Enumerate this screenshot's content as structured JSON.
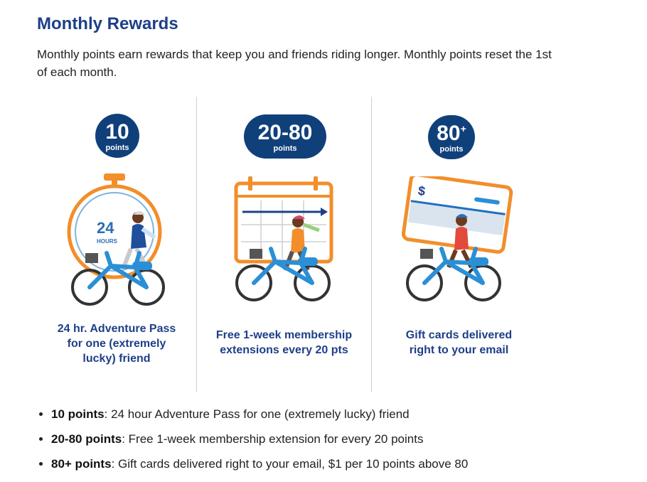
{
  "title": "Monthly Rewards",
  "intro": "Monthly points earn rewards that keep you and friends riding longer. Monthly points reset the 1st of each month.",
  "tiers": [
    {
      "badge_number": "10",
      "badge_sup": "",
      "badge_label": "points",
      "timer_big": "24",
      "timer_small": "HOURS",
      "caption_lines": [
        "24 hr. Adventure Pass",
        "for one (extremely",
        "lucky) friend"
      ]
    },
    {
      "badge_number": "20-80",
      "badge_sup": "",
      "badge_label": "points",
      "caption_lines": [
        "Free 1-week membership",
        "extensions every 20 pts"
      ]
    },
    {
      "badge_number": "80",
      "badge_sup": "+",
      "badge_label": "points",
      "card_symbol": "$",
      "caption_lines": [
        "Gift cards delivered",
        "right to your email"
      ]
    }
  ],
  "bullets": [
    {
      "label": "10 points",
      "text": ": 24 hour Adventure Pass for one (extremely lucky) friend"
    },
    {
      "label": "20-80 points",
      "text": ": Free 1-week membership extension for every 20 points"
    },
    {
      "label": "80+ points",
      "text": ": Gift cards delivered right to your email, $1 per 10 points above 80"
    }
  ],
  "colors": {
    "heading": "#1e3f88",
    "badge": "#10407a",
    "accent_orange": "#f28e2b",
    "bike_blue": "#2b8fd6"
  },
  "icons": [
    "stopwatch-icon",
    "calendar-icon",
    "gift-card-icon",
    "bicycle-rider-icon"
  ]
}
